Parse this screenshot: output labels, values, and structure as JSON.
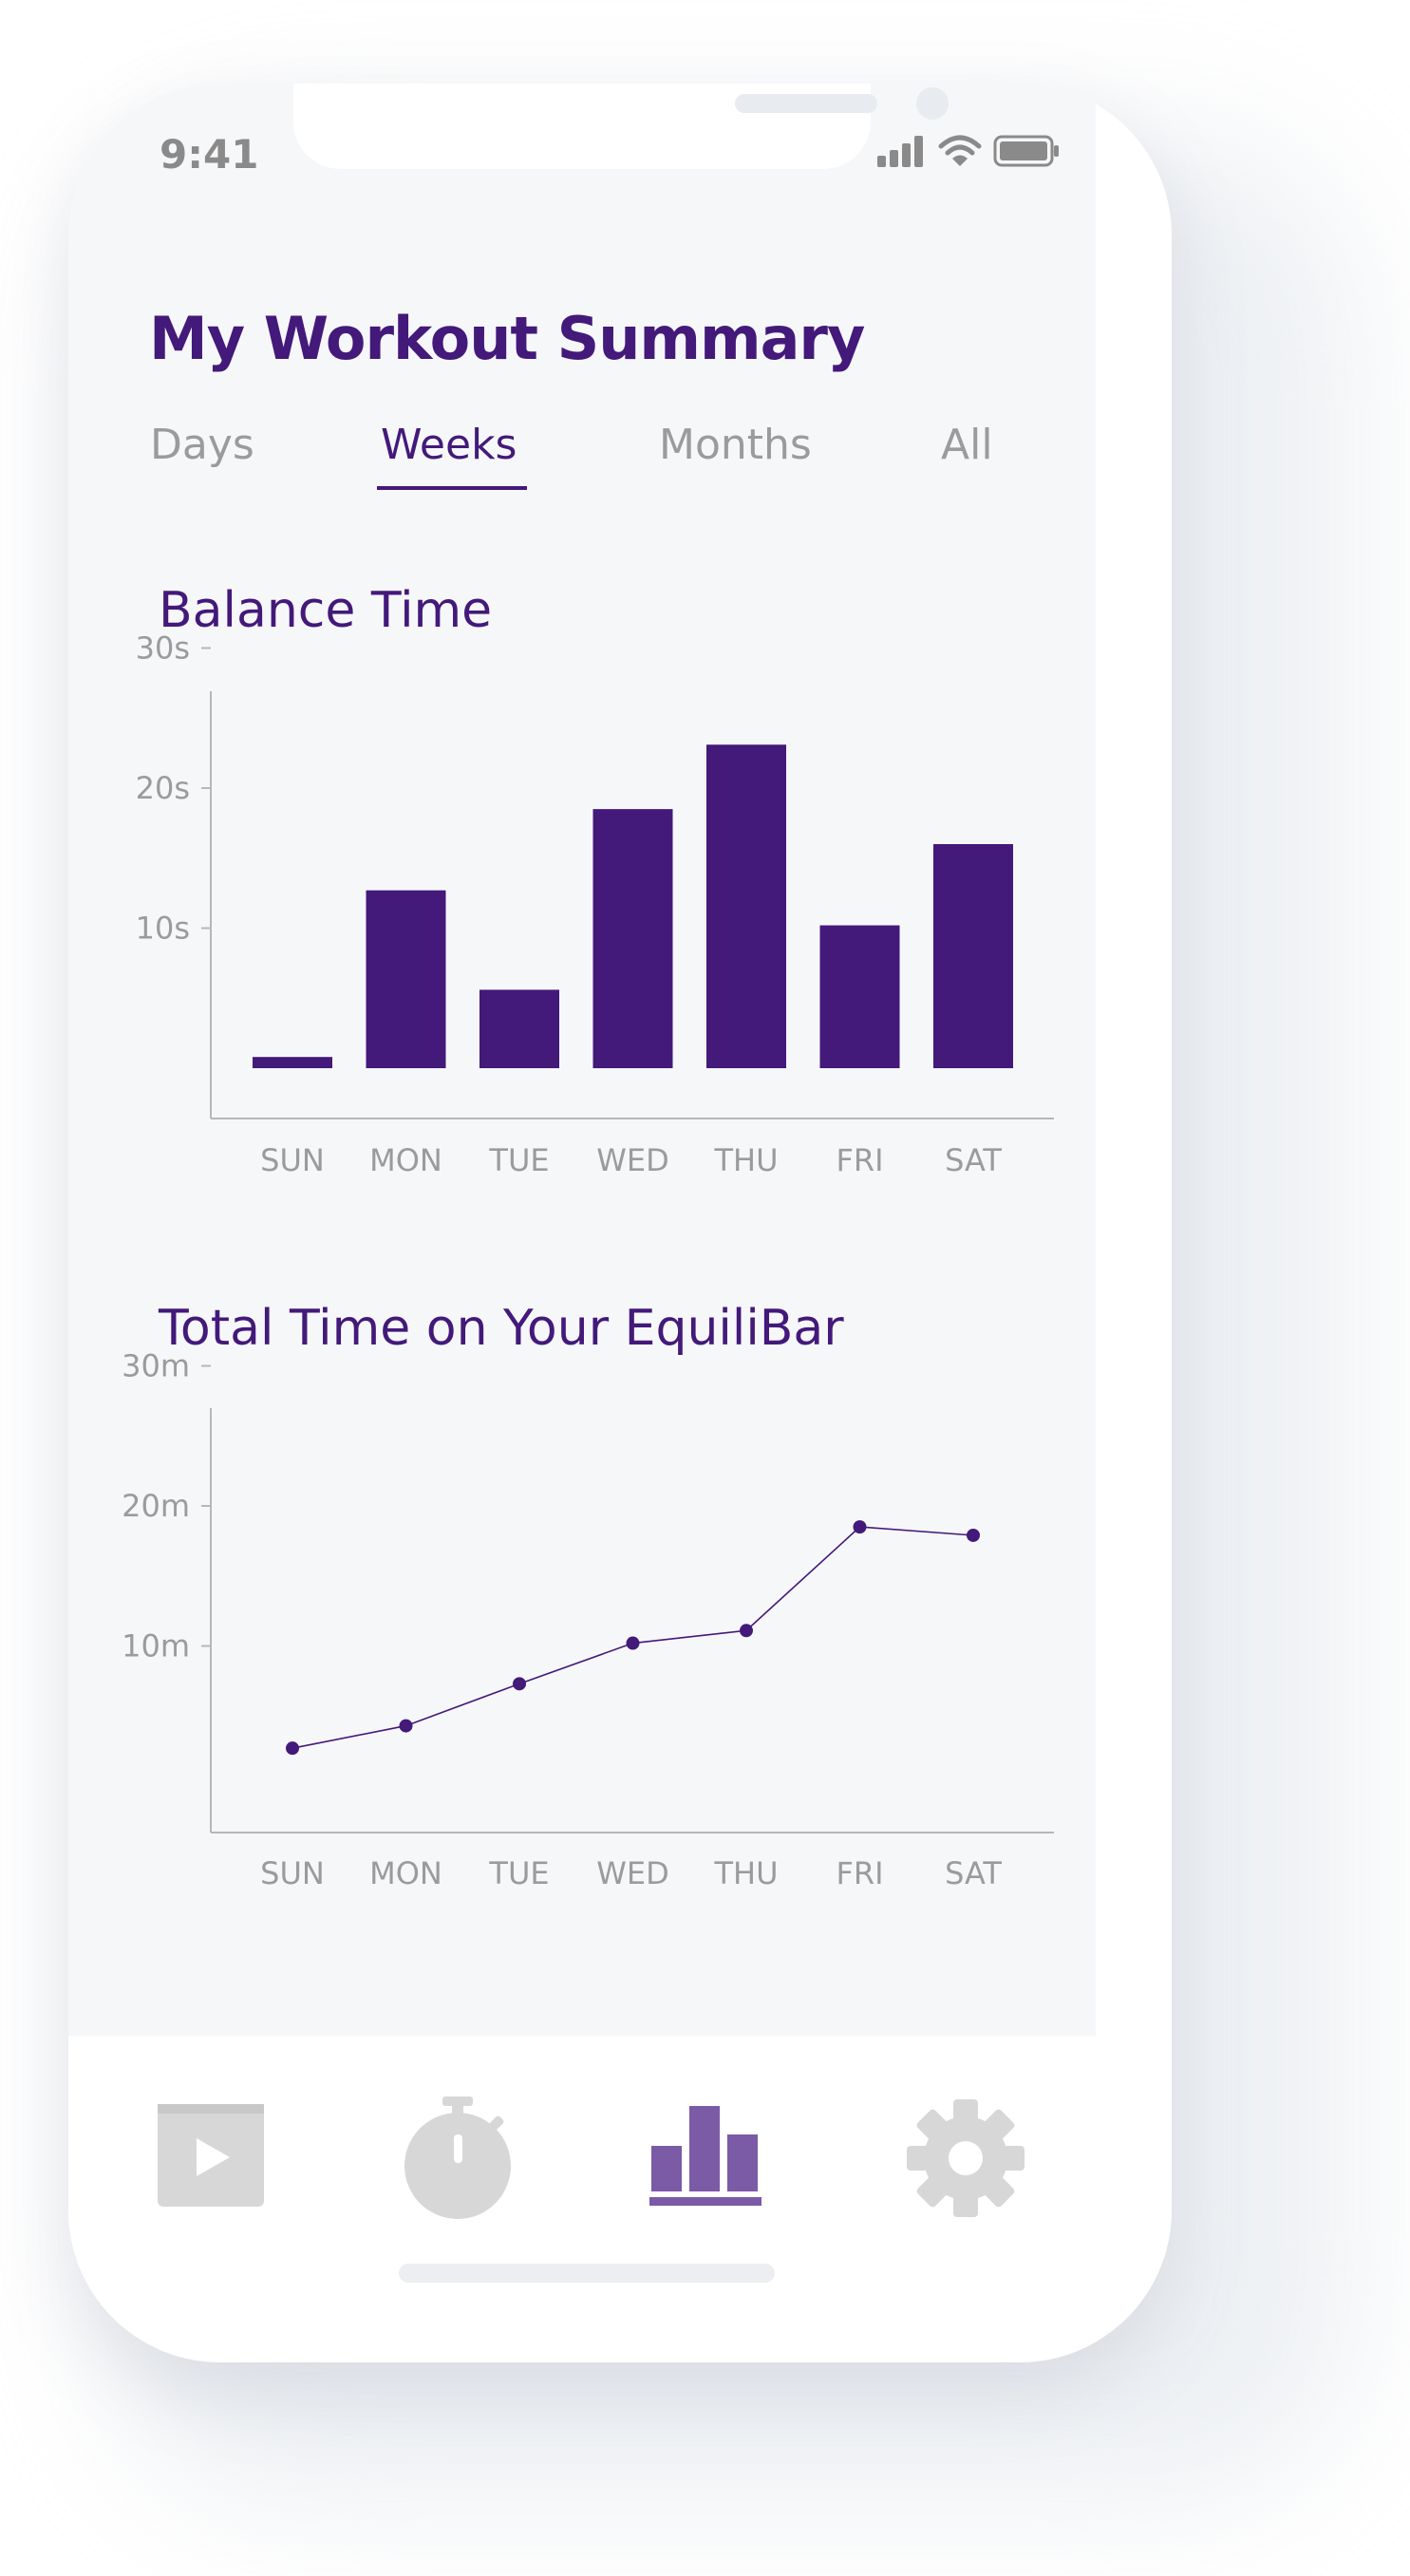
{
  "status_bar": {
    "time": "9:41",
    "icons": [
      "signal-icon",
      "wifi-icon",
      "battery-icon"
    ]
  },
  "header": {
    "title": "My Workout Summary"
  },
  "tabs": [
    {
      "label": "Days",
      "active": false
    },
    {
      "label": "Weeks",
      "active": true
    },
    {
      "label": "Months",
      "active": false
    },
    {
      "label": "All",
      "active": false
    }
  ],
  "balance": {
    "title": "Balance Time"
  },
  "total": {
    "title": "Total Time on Your EquiliBar"
  },
  "colors": {
    "accent": "#43197a",
    "inactive": "#9b9b9b",
    "nav_active": "#7b5aa6",
    "nav_inactive": "#d7d7d7"
  },
  "nav": [
    {
      "icon": "video-play-icon",
      "active": false
    },
    {
      "icon": "stopwatch-icon",
      "active": false
    },
    {
      "icon": "bar-chart-icon",
      "active": true
    },
    {
      "icon": "gear-icon",
      "active": false
    }
  ],
  "chart_data": [
    {
      "type": "bar",
      "title": "Balance Time",
      "categories": [
        "SUN",
        "MON",
        "TUE",
        "WED",
        "THU",
        "FRI",
        "SAT"
      ],
      "values": [
        0.8,
        12.7,
        5.6,
        18.5,
        23.1,
        10.2,
        16.0
      ],
      "y_ticks": [
        "10s",
        "20s",
        "30s"
      ],
      "y_tick_values": [
        10,
        20,
        30
      ],
      "ylim": [
        0,
        30
      ]
    },
    {
      "type": "line",
      "title": "Total Time on Your EquiliBar",
      "categories": [
        "SUN",
        "MON",
        "TUE",
        "WED",
        "THU",
        "FRI",
        "SAT"
      ],
      "values": [
        2.7,
        4.3,
        7.3,
        10.2,
        11.1,
        18.5,
        17.9
      ],
      "y_ticks": [
        "10m",
        "20m",
        "30m"
      ],
      "y_tick_values": [
        10,
        20,
        30
      ],
      "ylim": [
        0,
        30
      ]
    }
  ]
}
